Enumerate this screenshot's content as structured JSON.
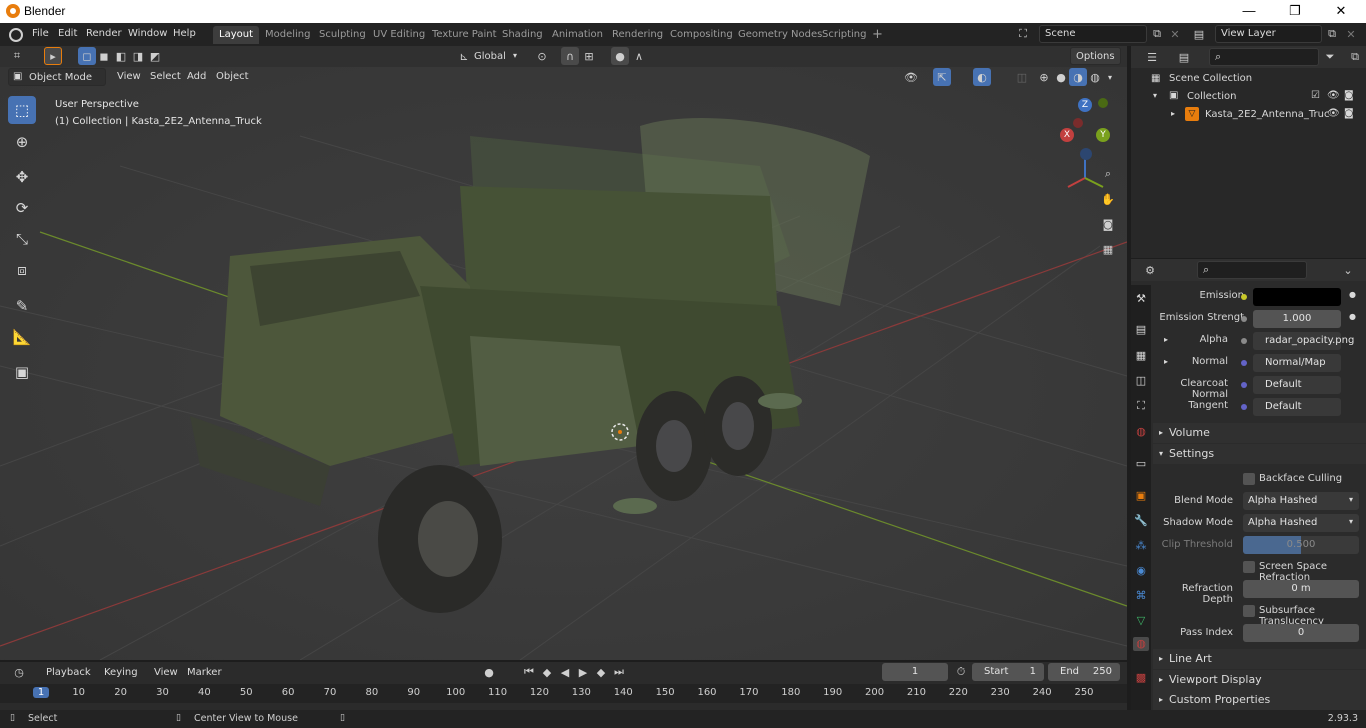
{
  "window": {
    "title": "Blender",
    "minimize": "—",
    "maximize": "❐",
    "close": "✕"
  },
  "menubar": {
    "items": [
      "File",
      "Edit",
      "Render",
      "Window",
      "Help"
    ]
  },
  "workspaces": {
    "tabs": [
      "Layout",
      "Modeling",
      "Sculpting",
      "UV Editing",
      "Texture Paint",
      "Shading",
      "Animation",
      "Rendering",
      "Compositing",
      "Geometry Nodes",
      "Scripting"
    ],
    "active": "Layout",
    "add": "+"
  },
  "scene": {
    "name": "Scene"
  },
  "view_layer": {
    "name": "View Layer"
  },
  "viewport_header": {
    "transform_orientation": "Global",
    "options": "Options",
    "mode": "Object Mode",
    "menus": [
      "View",
      "Select",
      "Add",
      "Object"
    ]
  },
  "viewport": {
    "perspective": "User Perspective",
    "collection_info": "(1) Collection | Kasta_2E2_Antenna_Truck",
    "gizmo_axes": {
      "x": "X",
      "y": "Y",
      "z": "Z"
    }
  },
  "outliner": {
    "root": "Scene Collection",
    "collection": "Collection",
    "object": "Kasta_2E2_Antenna_Truc"
  },
  "properties": {
    "rows": [
      {
        "label": "Emission",
        "value": "",
        "dot": "#c7c729",
        "swatch": "#000000"
      },
      {
        "label": "Emission Strengt",
        "value": "1.000",
        "dot": "#636363"
      },
      {
        "label": "Alpha",
        "value": "radar_opacity.png",
        "dot": "#636363",
        "expand": "▸"
      },
      {
        "label": "Normal",
        "value": "Normal/Map",
        "dot": "#6363c7",
        "expand": "▸"
      },
      {
        "label": "Clearcoat Normal",
        "value": "Default",
        "dot": "#6363c7"
      },
      {
        "label": "Tangent",
        "value": "Default",
        "dot": "#6363c7"
      }
    ],
    "volume": "Volume",
    "settings": "Settings",
    "backface_culling": "Backface Culling",
    "blend_mode_label": "Blend Mode",
    "blend_mode": "Alpha Hashed",
    "shadow_mode_label": "Shadow Mode",
    "shadow_mode": "Alpha Hashed",
    "clip_threshold_label": "Clip Threshold",
    "clip_threshold": "0.500",
    "screen_space_refraction": "Screen Space Refraction",
    "refraction_depth_label": "Refraction Depth",
    "refraction_depth": "0 m",
    "subsurface_translucency": "Subsurface Translucency",
    "pass_index_label": "Pass Index",
    "pass_index": "0",
    "line_art": "Line Art",
    "viewport_display": "Viewport Display",
    "custom_properties": "Custom Properties"
  },
  "timeline": {
    "menus": [
      "Playback",
      "Keying",
      "View",
      "Marker"
    ],
    "current_frame": "1",
    "start_label": "Start",
    "start": "1",
    "end_label": "End",
    "end": "250",
    "ruler": [
      "1",
      "10",
      "20",
      "30",
      "40",
      "50",
      "60",
      "70",
      "80",
      "90",
      "100",
      "110",
      "120",
      "130",
      "140",
      "150",
      "160",
      "170",
      "180",
      "190",
      "200",
      "210",
      "220",
      "230",
      "240",
      "250"
    ],
    "playhead": 1
  },
  "statusbar": {
    "select": "Select",
    "center_view": "Center View to Mouse",
    "version": "2.93.3"
  }
}
